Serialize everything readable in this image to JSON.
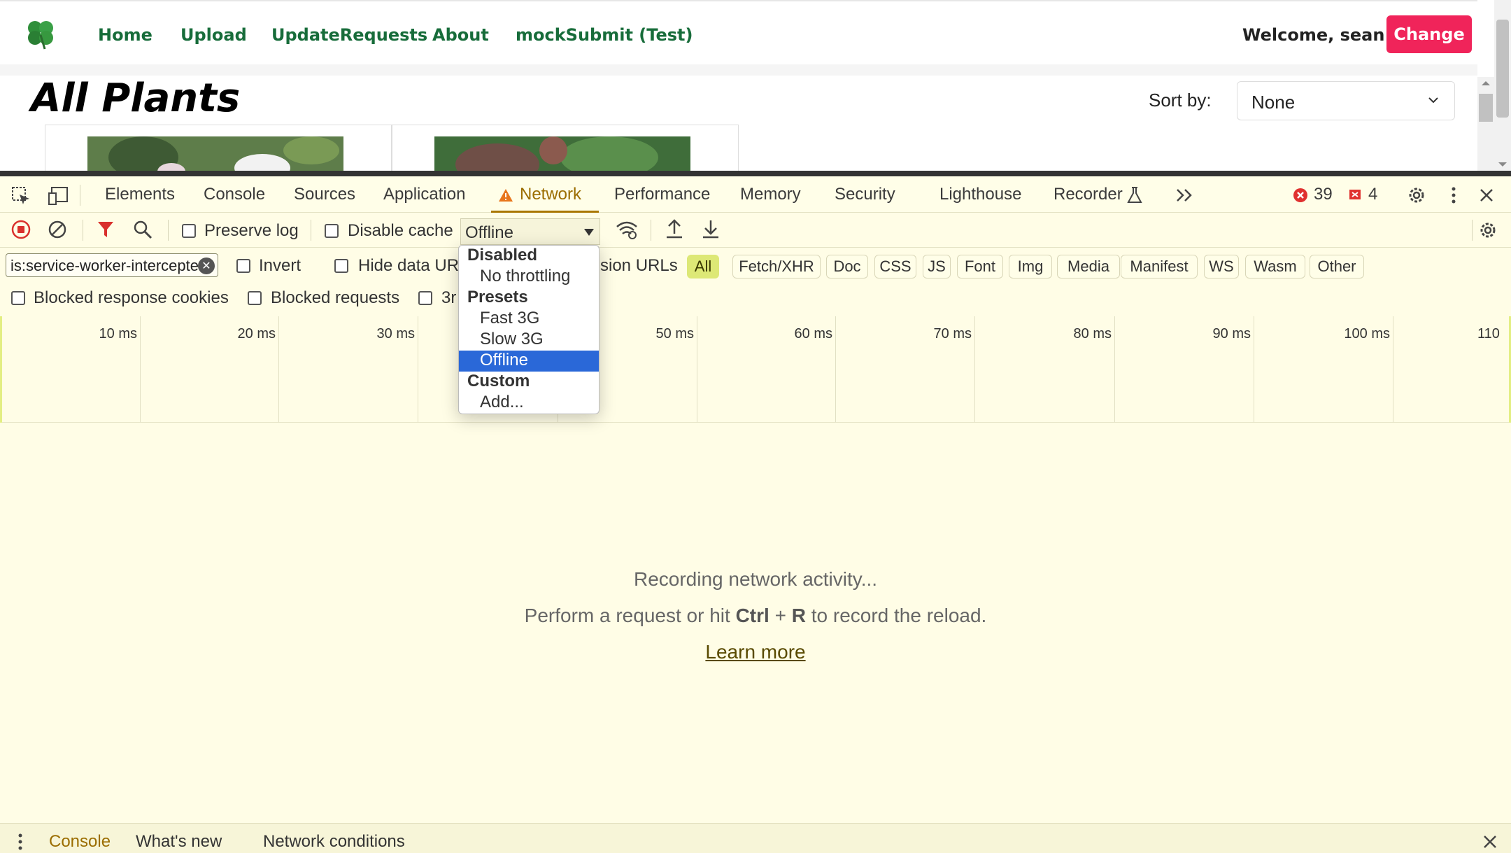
{
  "app": {
    "nav": [
      "Home",
      "Upload",
      "UpdateRequests",
      "About",
      "mockSubmit (Test)"
    ],
    "welcome": "Welcome, sean",
    "change_label": "Change",
    "page_title": "All Plants",
    "sort_label": "Sort by:",
    "sort_value": "None"
  },
  "devtools": {
    "tabs": [
      "Elements",
      "Console",
      "Sources",
      "Application",
      "Network",
      "Performance",
      "Memory",
      "Security",
      "Lighthouse",
      "Recorder"
    ],
    "active_tab": "Network",
    "error_count": "39",
    "issue_count": "4",
    "toolbar": {
      "preserve_log": "Preserve log",
      "disable_cache": "Disable cache",
      "throttle_value": "Offline"
    },
    "filter": {
      "value": "is:service-worker-intercepted",
      "invert": "Invert",
      "hide_data_urls": "Hide data UR",
      "extension_urls": "sion URLs",
      "types": [
        "All",
        "Fetch/XHR",
        "Doc",
        "CSS",
        "JS",
        "Font",
        "Img",
        "Media",
        "Manifest",
        "WS",
        "Wasm",
        "Other"
      ],
      "active_type": "All"
    },
    "checks": {
      "blocked_cookies": "Blocked response cookies",
      "blocked_requests": "Blocked requests",
      "third_party": "3r"
    },
    "timeline_ticks": [
      "10 ms",
      "20 ms",
      "30 ms",
      "",
      "50 ms",
      "60 ms",
      "70 ms",
      "80 ms",
      "90 ms",
      "100 ms",
      "110"
    ],
    "empty": {
      "recording": "Recording network activity...",
      "perform_prefix": "Perform a request or hit ",
      "shortcut_ctrl": "Ctrl",
      "shortcut_plus": " + ",
      "shortcut_r": "R",
      "perform_suffix": " to record the reload.",
      "learn_more": "Learn more"
    },
    "drawer_tabs": [
      "Console",
      "What's new",
      "Network conditions"
    ],
    "dropdown": {
      "groups": [
        {
          "label": "Disabled",
          "options": [
            "No throttling"
          ]
        },
        {
          "label": "Presets",
          "options": [
            "Fast 3G",
            "Slow 3G",
            "Offline"
          ]
        },
        {
          "label": "Custom",
          "options": [
            "Add..."
          ]
        }
      ],
      "selected": "Offline"
    }
  },
  "colors": {
    "accent_pink": "#f0245a",
    "nav_green": "#176c3a",
    "devtools_bg": "#fffde6",
    "selected_blue": "#2a68d8"
  }
}
